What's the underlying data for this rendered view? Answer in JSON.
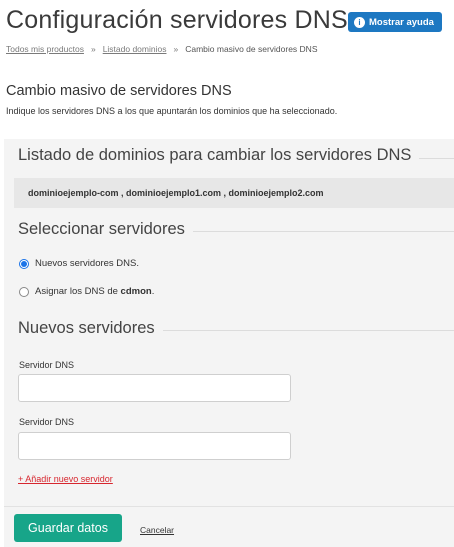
{
  "page": {
    "title": "Configuración servidores DNS",
    "help_button": "Mostrar ayuda",
    "help_icon": "info-icon"
  },
  "breadcrumb": {
    "items": [
      "Todos mis productos",
      "Listado dominios",
      "Cambio masivo de servidores DNS"
    ],
    "separator": "»"
  },
  "section": {
    "title": "Cambio masivo de servidores DNS",
    "description": "Indique los servidores DNS a los que apuntarán los dominios que ha seleccionado."
  },
  "domains_fieldset": {
    "legend": "Listado de dominios para cambiar los servidores DNS",
    "domains": "dominioejemplo-com , dominioejemplo1.com , dominioejemplo2.com"
  },
  "servers_select": {
    "legend": "Seleccionar servidores",
    "options": [
      {
        "label": "Nuevos servidores DNS.",
        "selected": true
      },
      {
        "label_prefix": "Asignar los DNS de ",
        "label_bold": "cdmon",
        "label_suffix": ".",
        "selected": false
      }
    ]
  },
  "new_servers": {
    "legend": "Nuevos servidores",
    "fields": [
      {
        "label": "Servidor DNS",
        "value": "",
        "placeholder": ""
      },
      {
        "label": "Servidor DNS",
        "value": "",
        "placeholder": ""
      }
    ],
    "add_link": "+ Añadir nuevo servidor"
  },
  "actions": {
    "save": "Guardar datos",
    "cancel": "Cancelar"
  },
  "colors": {
    "help_button": "#1d78c2",
    "save_button": "#17a589",
    "add_link": "#d7262e",
    "radio_selected": "#1a73e8"
  }
}
